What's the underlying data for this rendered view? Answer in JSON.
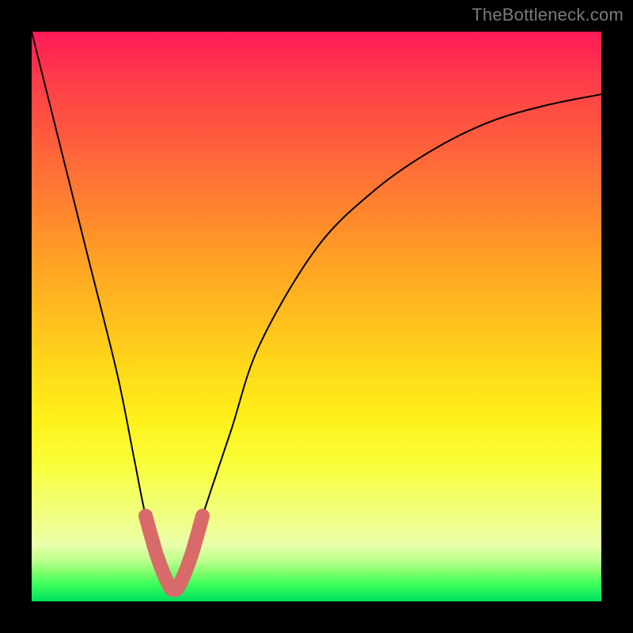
{
  "watermark": "TheBottleneck.com",
  "chart_data": {
    "type": "line",
    "title": "",
    "xlabel": "",
    "ylabel": "",
    "xlim": [
      0,
      100
    ],
    "ylim": [
      0,
      100
    ],
    "grid": false,
    "legend": false,
    "series": [
      {
        "name": "bottleneck-curve",
        "x": [
          0,
          5,
          10,
          15,
          18,
          20,
          22,
          24,
          25,
          26,
          28,
          30,
          35,
          40,
          50,
          60,
          70,
          80,
          90,
          100
        ],
        "values": [
          100,
          80,
          60,
          40,
          25,
          15,
          8,
          3,
          2,
          3,
          8,
          15,
          30,
          45,
          62,
          72,
          79,
          84,
          87,
          89
        ]
      }
    ],
    "highlight": {
      "name": "optimal-range",
      "x_range": [
        20,
        30
      ],
      "color": "#d86a6a"
    },
    "background_gradient": {
      "top": "#ff1a57",
      "mid": "#ffe320",
      "bottom": "#00e060"
    }
  }
}
